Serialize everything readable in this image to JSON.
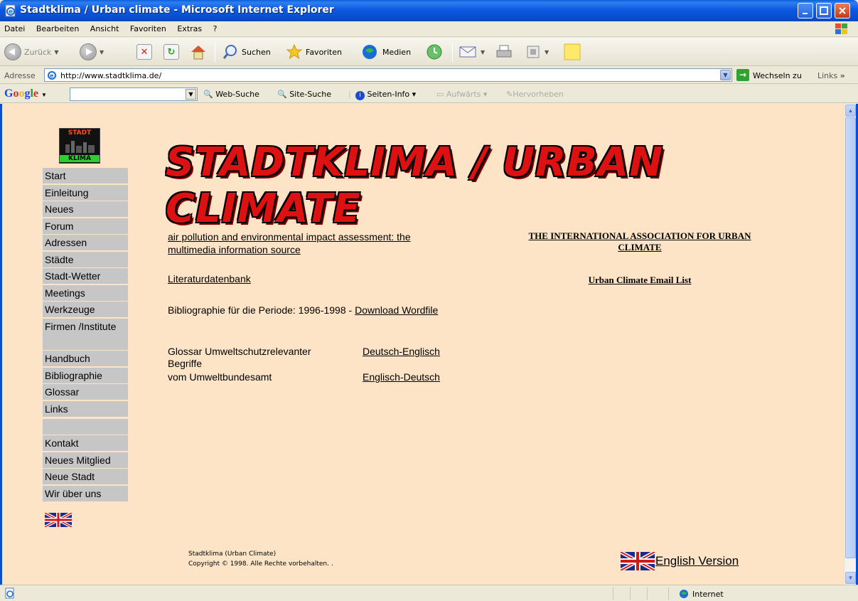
{
  "window": {
    "title": "Stadtklima / Urban climate - Microsoft Internet Explorer"
  },
  "menu": [
    "Datei",
    "Bearbeiten",
    "Ansicht",
    "Favoriten",
    "Extras",
    "?"
  ],
  "toolbar": {
    "back": "Zurück",
    "search": "Suchen",
    "favorites": "Favoriten",
    "media": "Medien"
  },
  "address": {
    "label": "Adresse",
    "url": "http://www.stadtklima.de/",
    "go": "Wechseln zu",
    "links": "Links"
  },
  "google": {
    "logo": "Google",
    "web_search": "Web-Suche",
    "site_search": "Site-Suche",
    "page_info": "Seiten-Info",
    "up": "Aufwärts",
    "highlight": "Hervorheben"
  },
  "page": {
    "logo_top": "STADT",
    "logo_bottom": "KLIMA",
    "banner": "STADTKLIMA / URBAN CLIMATE",
    "nav": [
      "Start",
      "Einleitung",
      "Neues",
      "Forum",
      "Adressen",
      "Städte",
      "Stadt-Wetter",
      "Meetings",
      "Werkzeuge",
      "Firmen /Institute",
      "Handbuch",
      "Bibliographie",
      "Glossar",
      "Links",
      "",
      "Kontakt",
      "Neues Mitglied",
      "Neue Stadt",
      "Wir über uns"
    ],
    "air_pollution_link": "air pollution and environmental impact assessment: the multimedia information source",
    "literatur_link": "Literaturdatenbank",
    "biblio_text": "Bibliographie für die Periode: 1996-1998  - ",
    "download_link": "Download Wordfile",
    "glossar_text_1": "Glossar Umweltschutzrelevanter Begriffe",
    "glossar_text_2": "vom Umweltbundesamt",
    "de_en_link": "Deutsch-Englisch",
    "en_de_link": "Englisch-Deutsch",
    "assoc_link": "THE INTERNATIONAL ASSOCIATION FOR URBAN CLIMATE",
    "email_list_link": "Urban Climate Email List",
    "footer_line1": "Stadtklima (Urban Climate)",
    "footer_line2": "Copyright © 1998. Alle Rechte vorbehalten. .",
    "english_version": "English Version"
  },
  "status": {
    "zone": "Internet"
  }
}
